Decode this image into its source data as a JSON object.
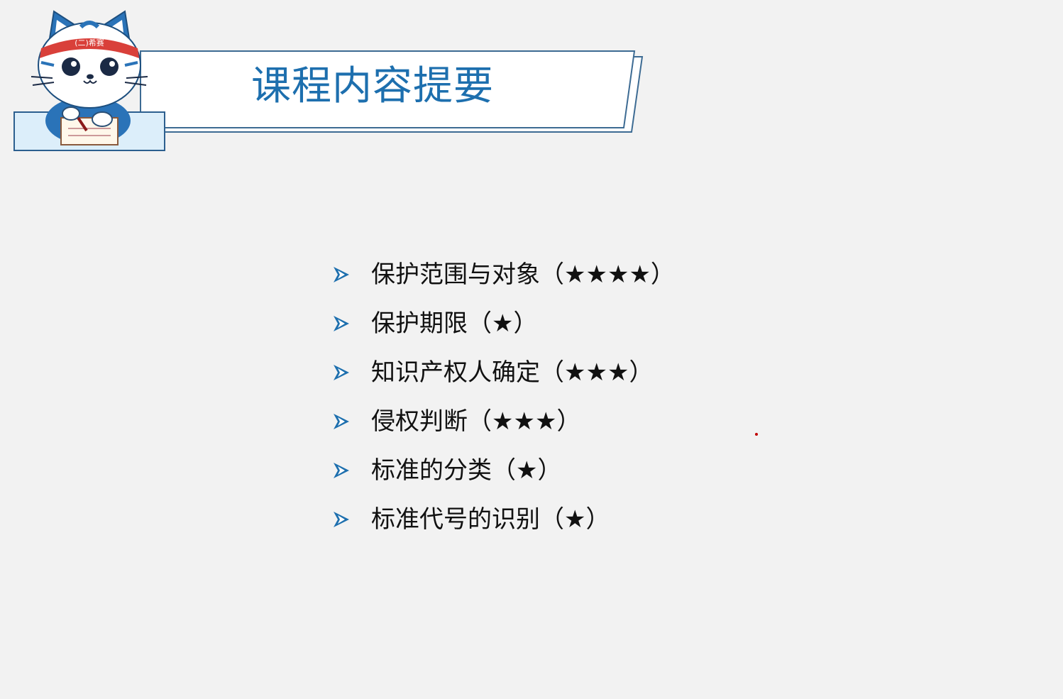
{
  "header": {
    "title": "课程内容提要",
    "mascot_headband": "(二)希赛"
  },
  "outline": {
    "items": [
      {
        "text": "保护范围与对象（★★★★）"
      },
      {
        "text": "保护期限（★）"
      },
      {
        "text": "知识产权人确定（★★★）"
      },
      {
        "text": "侵权判断（★★★）"
      },
      {
        "text": "标准的分类（★）"
      },
      {
        "text": "标准代号的识别（★）"
      }
    ]
  },
  "colors": {
    "background": "#f2f2f2",
    "accent": "#1d6fae",
    "banner_border": "#3d6b93",
    "banner_fill": "#ffffff",
    "text": "#111111"
  },
  "icons": {
    "bullet": "arrow-bullet-icon",
    "mascot": "cat-mascot-icon"
  }
}
